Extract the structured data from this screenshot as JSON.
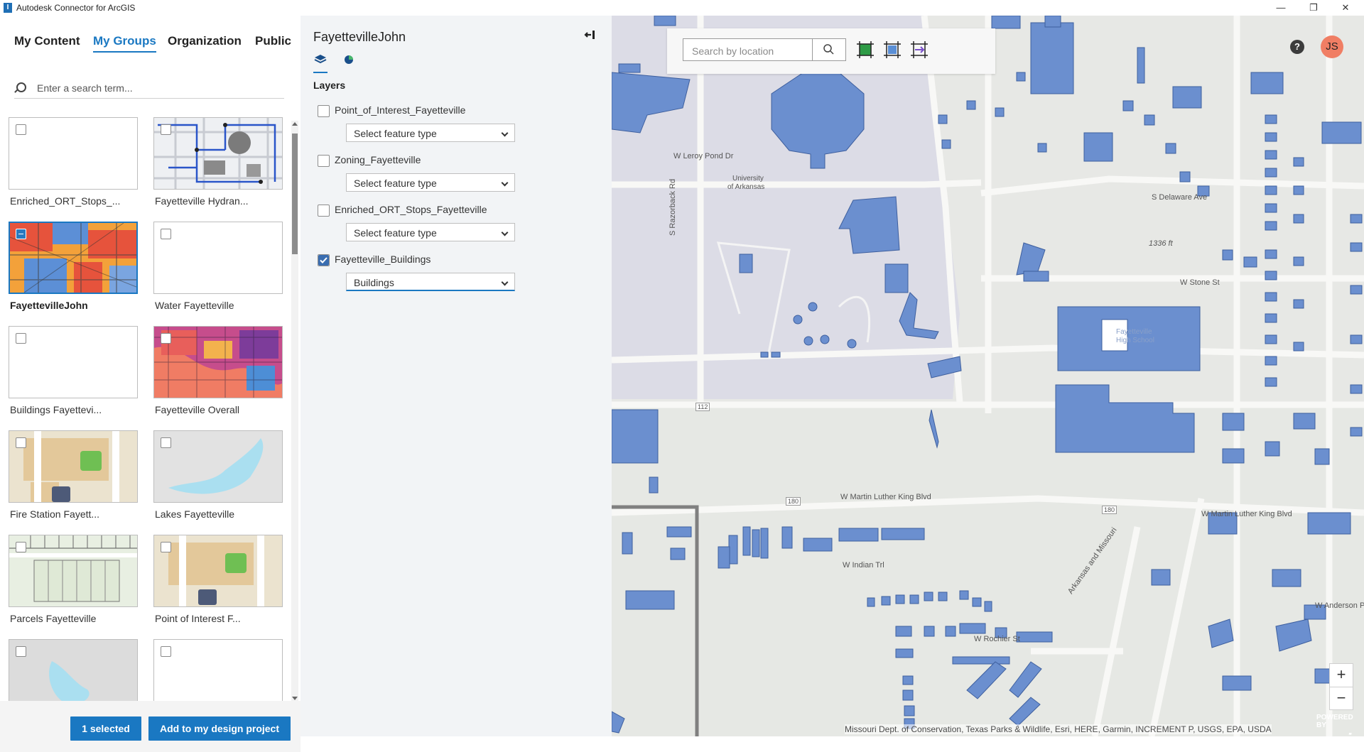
{
  "window": {
    "title": "Autodesk Connector for ArcGIS",
    "app_icon": "I"
  },
  "window_controls": {
    "minimize": "—",
    "restore": "❐",
    "close": "✕"
  },
  "left_tabs": [
    {
      "label": "My Content"
    },
    {
      "label": "My Groups"
    },
    {
      "label": "Organization"
    },
    {
      "label": "Public"
    }
  ],
  "search": {
    "placeholder": "Enter a search term..."
  },
  "items": [
    {
      "label": "Enriched_ORT_Stops_..."
    },
    {
      "label": "Fayetteville Hydran..."
    },
    {
      "label": "FayettevilleJohn"
    },
    {
      "label": "Water Fayetteville"
    },
    {
      "label": "Buildings Fayettevi..."
    },
    {
      "label": "Fayetteville Overall"
    },
    {
      "label": "Fire Station Fayett..."
    },
    {
      "label": "Lakes Fayetteville"
    },
    {
      "label": "Parcels Fayetteville"
    },
    {
      "label": "Point of Interest F..."
    },
    {
      "label": ""
    },
    {
      "label": ""
    }
  ],
  "footer": {
    "selected_label": "1 selected",
    "add_label": "Add to my design project"
  },
  "details": {
    "title": "FayettevilleJohn",
    "layers_heading": "Layers",
    "layers": [
      {
        "name": "Point_of_Interest_Fayetteville",
        "checked": false,
        "feature_type": "Select feature type"
      },
      {
        "name": "Zoning_Fayetteville",
        "checked": false,
        "feature_type": "Select feature type"
      },
      {
        "name": "Enriched_ORT_Stops_Fayetteville",
        "checked": false,
        "feature_type": "Select feature type"
      },
      {
        "name": "Fayetteville_Buildings",
        "checked": true,
        "feature_type": "Buildings"
      }
    ]
  },
  "map": {
    "search_placeholder": "Search by location",
    "help": "?",
    "user_initials": "JS",
    "zoom_in": "+",
    "zoom_out": "−",
    "attribution": "Missouri Dept. of Conservation, Texas Parks & Wildlife, Esri, HERE, Garmin, INCREMENT P, USGS, EPA, USDA",
    "esri_powered": "POWERED BY",
    "esri_logo": "esri",
    "labels": {
      "leroy": "W Leroy Pond Dr",
      "university": "University",
      "of_arkansas": "of Arkansas",
      "razorback": "S Razorback Rd",
      "mlk": "W Martin Luther King Blvd",
      "mlk2": "W Martin Luther King Blvd",
      "indian": "W Indian Trl",
      "rochier": "W Rochier St",
      "stone": "W Stone St",
      "delaware": "S Delaware Ave",
      "ft1336": "1336 ft",
      "hs1": "Fayetteville",
      "hs2": "High School",
      "r112": "112",
      "r180": "180",
      "r180b": "180",
      "anderson": "W Anderson Pl",
      "arkmo": "Arkansas and Missouri"
    },
    "colors": {
      "building": "#6b8fcf",
      "building_stroke": "#3e5f9e",
      "campus": "#dddde6",
      "road": "#f6f6f4"
    }
  }
}
